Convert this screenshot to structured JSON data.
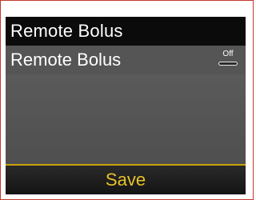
{
  "screen": {
    "title": "Remote Bolus",
    "row": {
      "label": "Remote Bolus",
      "toggle_state": "Off"
    },
    "softkey": {
      "label": "Save"
    }
  },
  "colors": {
    "accent": "#e6c228",
    "title_bg": "#0b0b0b",
    "screen_bg": "#4a4a4a",
    "frame_border": "#c0392b"
  }
}
